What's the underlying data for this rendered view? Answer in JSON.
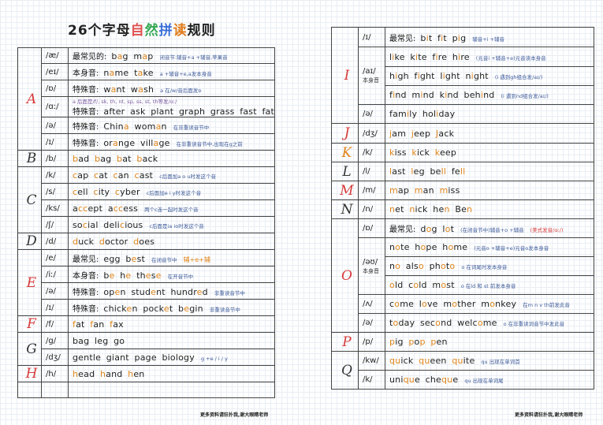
{
  "title": {
    "part1": "26个字母",
    "part2": "自",
    "part3": "然",
    "part4": "拼",
    "part5": "读",
    "part6": "规则"
  },
  "colors": {
    "title_zi": "#e05050",
    "title_ran": "#33a853",
    "title_pin": "#3d6fd8",
    "title_du": "#e07b1a",
    "highlight": "#e0851a",
    "letter_red": "#d63a3a",
    "note_blue": "#3d5a99"
  },
  "left": {
    "rows": [
      {
        "letter": "A",
        "ipa": "/æ/",
        "label": "最常见的:",
        "pre": "",
        "words": [
          [
            "b",
            ""
          ],
          [
            "a",
            "h"
          ],
          [
            "g  m",
            ""
          ],
          [
            "a",
            "h"
          ],
          [
            "p",
            ""
          ]
        ],
        "note": "闭音节:辅音+a +辅音,苹果音"
      },
      {
        "ipa": "/eɪ/",
        "label": "本身音:",
        "words": [
          [
            "n",
            ""
          ],
          [
            "a",
            "h"
          ],
          [
            "me  t",
            ""
          ],
          [
            "a",
            "h"
          ],
          [
            "ke",
            ""
          ]
        ],
        "note": "a +辅音+e,a发本身音"
      },
      {
        "ipa": "/ɒ/",
        "label": "特殊音:",
        "words": [
          [
            "w",
            ""
          ],
          [
            "a",
            "h"
          ],
          [
            "nt  w",
            ""
          ],
          [
            "a",
            "h"
          ],
          [
            "sh",
            ""
          ]
        ],
        "note": "a 在/w/音后面发ɒ"
      },
      {
        "ipa": "/ɑː/",
        "label": "特殊音:",
        "words": [
          [
            "after  ask  plant  graph  grass  fast  father",
            ""
          ]
        ],
        "note": "",
        "topnote": "a 后面是/f/, sk, th, nt, sp, ss, st, th等发/ɑː/"
      },
      {
        "ipa": "/ə/",
        "label": "特殊音:",
        "words": [
          [
            "Chin",
            ""
          ],
          [
            "a",
            "h"
          ],
          [
            "  wom",
            ""
          ],
          [
            "a",
            "h"
          ],
          [
            "n",
            ""
          ]
        ],
        "note": "在非重读音节中"
      },
      {
        "ipa": "/ɪ/",
        "label": "特殊音:",
        "words": [
          [
            "or",
            ""
          ],
          [
            "a",
            "h"
          ],
          [
            "nge  vill",
            ""
          ],
          [
            "a",
            "h"
          ],
          [
            "ge",
            ""
          ]
        ],
        "note": "在非重读音节中,出现在g之前"
      },
      {
        "letter": "B",
        "ipa": "/b/",
        "label": "",
        "words": [
          [
            "b",
            "h"
          ],
          [
            "ad  ",
            ""
          ],
          [
            "b",
            "h"
          ],
          [
            "ag  ",
            ""
          ],
          [
            "b",
            "h"
          ],
          [
            "at  ",
            ""
          ],
          [
            "b",
            "h"
          ],
          [
            "ack",
            ""
          ]
        ],
        "note": ""
      },
      {
        "letter": "C",
        "ipa": "/k/",
        "label": "",
        "words": [
          [
            "c",
            "h"
          ],
          [
            "ap  ",
            ""
          ],
          [
            "c",
            "h"
          ],
          [
            "at  ",
            ""
          ],
          [
            "c",
            "h"
          ],
          [
            "an  ",
            ""
          ],
          [
            "c",
            "h"
          ],
          [
            "ast",
            ""
          ]
        ],
        "note": "c后面加a o u时发这个音"
      },
      {
        "ipa": "/s/",
        "label": "",
        "words": [
          [
            "c",
            "h"
          ],
          [
            "ell  ",
            ""
          ],
          [
            "c",
            "h"
          ],
          [
            "ity  ",
            ""
          ],
          [
            "c",
            "h"
          ],
          [
            "yber",
            ""
          ]
        ],
        "note": "c后面加e i y时发这个音"
      },
      {
        "ipa": "/ks/",
        "label": "",
        "words": [
          [
            "a",
            ""
          ],
          [
            "cc",
            "h"
          ],
          [
            "ept  a",
            ""
          ],
          [
            "cc",
            "h"
          ],
          [
            "ess",
            ""
          ]
        ],
        "note": "两个c连一起时发这个音"
      },
      {
        "ipa": "/ʃ/",
        "label": "",
        "words": [
          [
            "so",
            ""
          ],
          [
            "c",
            "h"
          ],
          [
            "ial  deli",
            ""
          ],
          [
            "c",
            "h"
          ],
          [
            "ious",
            ""
          ]
        ],
        "note": "c后面是ia io时发这个音"
      },
      {
        "letter": "D",
        "ipa": "/d/",
        "label": "",
        "words": [
          [
            "d",
            "h"
          ],
          [
            "uck  ",
            ""
          ],
          [
            "d",
            "h"
          ],
          [
            "octor  ",
            ""
          ],
          [
            "d",
            "h"
          ],
          [
            "oes",
            ""
          ]
        ],
        "note": ""
      },
      {
        "letter": "E",
        "ipa": "/e/",
        "label": "最常见:",
        "words": [
          [
            "egg  b",
            ""
          ],
          [
            "e",
            "h"
          ],
          [
            "st",
            ""
          ]
        ],
        "note": "在闭音节中"
      },
      {
        "ipa": "/iː/",
        "label": "本身音:",
        "words": [
          [
            "b",
            ""
          ],
          [
            "e",
            "h"
          ],
          [
            "  h",
            ""
          ],
          [
            "e",
            "h"
          ],
          [
            "  th",
            ""
          ],
          [
            "e",
            "h"
          ],
          [
            "s",
            ""
          ],
          [
            "e",
            "h"
          ]
        ],
        "note": "在开音节中"
      },
      {
        "ipa": "/ə/",
        "label": "特殊音:",
        "words": [
          [
            "op",
            ""
          ],
          [
            "e",
            "h"
          ],
          [
            "n  stud",
            ""
          ],
          [
            "e",
            "h"
          ],
          [
            "nt  hundr",
            ""
          ],
          [
            "e",
            "h"
          ],
          [
            "d",
            ""
          ]
        ],
        "note": "非重读音节中"
      },
      {
        "ipa": "/ɪ/",
        "label": "特殊音:",
        "words": [
          [
            "chick",
            ""
          ],
          [
            "e",
            "h"
          ],
          [
            "n  pock",
            ""
          ],
          [
            "e",
            "h"
          ],
          [
            "t  b",
            ""
          ],
          [
            "e",
            "h"
          ],
          [
            "gin",
            ""
          ]
        ],
        "note": "非重读音节中"
      },
      {
        "letter": "F",
        "ipa": "/f/",
        "label": "",
        "words": [
          [
            "f",
            "h"
          ],
          [
            "at  ",
            ""
          ],
          [
            "f",
            "h"
          ],
          [
            "an  ",
            ""
          ],
          [
            "f",
            "h"
          ],
          [
            "ax",
            ""
          ]
        ],
        "note": ""
      },
      {
        "letter": "G",
        "ipa": "/g/",
        "label": "",
        "words": [
          [
            "bag  leg  go",
            ""
          ]
        ],
        "note": ""
      },
      {
        "ipa": "/dʒ/",
        "label": "",
        "words": [
          [
            "gentle  giant  page  biology",
            ""
          ]
        ],
        "note": "g +e / i / y"
      },
      {
        "letter": "H",
        "ipa": "/h/",
        "label": "",
        "words": [
          [
            "h",
            "h"
          ],
          [
            "ead  ",
            ""
          ],
          [
            "h",
            "h"
          ],
          [
            "and  ",
            ""
          ],
          [
            "h",
            "h"
          ],
          [
            "en",
            ""
          ]
        ],
        "note": ""
      }
    ],
    "note_e1": "辅+e+辅",
    "footer": "更多资料请狂扑我,谢大眼睛老师"
  },
  "right": {
    "rows": [
      {
        "letter": "I",
        "ipa": "/ɪ/",
        "label": "最常见:",
        "words": [
          [
            "b",
            ""
          ],
          [
            "i",
            "h"
          ],
          [
            "t  f",
            ""
          ],
          [
            "i",
            "h"
          ],
          [
            "t  p",
            ""
          ],
          [
            "i",
            "h"
          ],
          [
            "g",
            ""
          ]
        ],
        "note": "辅音+i +辅音"
      },
      {
        "ipa": "/aɪ/",
        "sub": "本身音",
        "label": "",
        "words": [
          [
            "l",
            ""
          ],
          [
            "i",
            "h"
          ],
          [
            "ke  k",
            ""
          ],
          [
            "i",
            "h"
          ],
          [
            "te  f",
            ""
          ],
          [
            "i",
            "h"
          ],
          [
            "re  h",
            ""
          ],
          [
            "i",
            "h"
          ],
          [
            "re",
            ""
          ]
        ],
        "note": "(元音i +辅音+e)元音读本身音"
      },
      {
        "ipa": "",
        "label": "",
        "words": [
          [
            "h",
            ""
          ],
          [
            "i",
            "h"
          ],
          [
            "gh  f",
            ""
          ],
          [
            "i",
            "h"
          ],
          [
            "ght  l",
            ""
          ],
          [
            "i",
            "h"
          ],
          [
            "ght  n",
            ""
          ],
          [
            "i",
            "h"
          ],
          [
            "ght",
            ""
          ]
        ],
        "note": "(i 遇到gh组合发/aɪ/)"
      },
      {
        "ipa": "",
        "label": "",
        "words": [
          [
            "f",
            ""
          ],
          [
            "i",
            "h"
          ],
          [
            "nd  m",
            ""
          ],
          [
            "i",
            "h"
          ],
          [
            "nd  k",
            ""
          ],
          [
            "i",
            "h"
          ],
          [
            "nd  beh",
            ""
          ],
          [
            "i",
            "h"
          ],
          [
            "nd",
            ""
          ]
        ],
        "note": "(i 遇到nd组合发/aɪ/)"
      },
      {
        "ipa": "/ə/",
        "label": "",
        "words": [
          [
            "fam",
            ""
          ],
          [
            "i",
            "h"
          ],
          [
            "ly  hol",
            ""
          ],
          [
            "i",
            "h"
          ],
          [
            "day",
            ""
          ]
        ],
        "note": ""
      },
      {
        "letter": "J",
        "ipa": "/dʒ/",
        "label": "",
        "words": [
          [
            "j",
            "h"
          ],
          [
            "am  ",
            ""
          ],
          [
            "j",
            "h"
          ],
          [
            "eep  ",
            ""
          ],
          [
            "J",
            "h"
          ],
          [
            "ack",
            ""
          ]
        ],
        "note": ""
      },
      {
        "letter": "K",
        "ipa": "/k/",
        "label": "",
        "words": [
          [
            "k",
            "h"
          ],
          [
            "iss  ",
            ""
          ],
          [
            "k",
            "h"
          ],
          [
            "ick  ",
            ""
          ],
          [
            "k",
            "h"
          ],
          [
            "eep",
            ""
          ]
        ],
        "note": ""
      },
      {
        "letter": "L",
        "ipa": "/l/",
        "label": "",
        "words": [
          [
            "l",
            "h"
          ],
          [
            "ast  ",
            ""
          ],
          [
            "l",
            "h"
          ],
          [
            "eg  be",
            ""
          ],
          [
            "ll",
            "h"
          ],
          [
            "  fe",
            ""
          ],
          [
            "ll",
            "h"
          ]
        ],
        "note": ""
      },
      {
        "letter": "M",
        "ipa": "/m/",
        "label": "",
        "words": [
          [
            "m",
            "h"
          ],
          [
            "ap  ",
            ""
          ],
          [
            "m",
            "h"
          ],
          [
            "an  ",
            ""
          ],
          [
            "m",
            "h"
          ],
          [
            "iss",
            ""
          ]
        ],
        "note": ""
      },
      {
        "letter": "N",
        "ipa": "/n/",
        "label": "",
        "words": [
          [
            "n",
            "h"
          ],
          [
            "et  ",
            ""
          ],
          [
            "n",
            "h"
          ],
          [
            "ick  he",
            ""
          ],
          [
            "n",
            "h"
          ],
          [
            "  Be",
            ""
          ],
          [
            "n",
            "h"
          ]
        ],
        "note": ""
      },
      {
        "letter": "O",
        "ipa": "/ɒ/",
        "label": "最常见:",
        "words": [
          [
            "d",
            ""
          ],
          [
            "o",
            "h"
          ],
          [
            "g  l",
            ""
          ],
          [
            "o",
            "h"
          ],
          [
            "t",
            ""
          ]
        ],
        "note": "(在闭音节中)辅音+o +辅音",
        "note_extra": "(美式发音/ɑː/)"
      },
      {
        "ipa": "/əʊ/",
        "sub": "本身音",
        "label": "",
        "words": [
          [
            "n",
            ""
          ],
          [
            "o",
            "h"
          ],
          [
            "te  h",
            ""
          ],
          [
            "o",
            "h"
          ],
          [
            "pe  h",
            ""
          ],
          [
            "o",
            "h"
          ],
          [
            "me",
            ""
          ]
        ],
        "note": "(元音o +辅音+e)元音o发本身音"
      },
      {
        "ipa": "",
        "label": "",
        "words": [
          [
            "n",
            ""
          ],
          [
            "o",
            "h"
          ],
          [
            "  als",
            ""
          ],
          [
            "o",
            "h"
          ],
          [
            "  ph",
            ""
          ],
          [
            "o",
            "h"
          ],
          [
            "t",
            ""
          ],
          [
            "o",
            "h"
          ]
        ],
        "note": "o 在词尾时发本身音"
      },
      {
        "ipa": "",
        "label": "",
        "words": [
          [
            "",
            ""
          ],
          [
            "o",
            "h"
          ],
          [
            "ld  c",
            ""
          ],
          [
            "o",
            "h"
          ],
          [
            "ld  m",
            ""
          ],
          [
            "o",
            "h"
          ],
          [
            "st",
            ""
          ]
        ],
        "note": "o 在ld 和 st 前发本身音"
      },
      {
        "ipa": "/ʌ/",
        "label": "",
        "words": [
          [
            "c",
            ""
          ],
          [
            "o",
            "h"
          ],
          [
            "me  l",
            ""
          ],
          [
            "o",
            "h"
          ],
          [
            "ve  m",
            ""
          ],
          [
            "o",
            "h"
          ],
          [
            "ther  m",
            ""
          ],
          [
            "o",
            "h"
          ],
          [
            "nkey",
            ""
          ]
        ],
        "note": "在m n v th前发此音"
      },
      {
        "ipa": "/ə/",
        "label": "",
        "words": [
          [
            "t",
            ""
          ],
          [
            "o",
            "h"
          ],
          [
            "day  sec",
            ""
          ],
          [
            "o",
            "h"
          ],
          [
            "nd  welc",
            ""
          ],
          [
            "o",
            "h"
          ],
          [
            "me",
            ""
          ]
        ],
        "note": "o 在非重读词音节中发此音"
      },
      {
        "letter": "P",
        "ipa": "/p/",
        "label": "",
        "words": [
          [
            "p",
            "h"
          ],
          [
            "ig  ",
            ""
          ],
          [
            "p",
            "h"
          ],
          [
            "o",
            ""
          ],
          [
            "p",
            "h"
          ],
          [
            "  ",
            ""
          ],
          [
            "p",
            "h"
          ],
          [
            "en",
            ""
          ]
        ],
        "note": ""
      },
      {
        "letter": "Q",
        "ipa": "/kw/",
        "label": "",
        "words": [
          [
            "qu",
            "h"
          ],
          [
            "ick  ",
            ""
          ],
          [
            "qu",
            "h"
          ],
          [
            "een  ",
            ""
          ],
          [
            "qu",
            "h"
          ],
          [
            "ite",
            ""
          ]
        ],
        "note": "qu 出现在单词首"
      },
      {
        "ipa": "/k/",
        "label": "",
        "words": [
          [
            "uni",
            ""
          ],
          [
            "qu",
            "h"
          ],
          [
            "e  che",
            ""
          ],
          [
            "qu",
            "h"
          ],
          [
            "e",
            ""
          ]
        ],
        "note": "qu 出现在单词尾"
      }
    ],
    "footer": "更多资料请狂扑我,谢大眼睛老师"
  }
}
